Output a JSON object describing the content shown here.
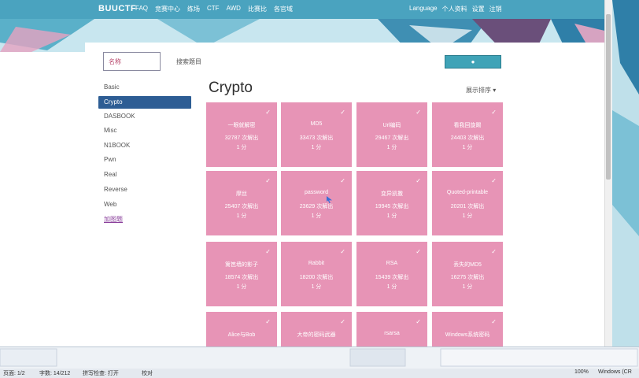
{
  "nav": {
    "brand": "BUUCTF",
    "items": [
      "FAQ",
      "竞赛中心",
      "练场",
      "CTF",
      "AWD",
      "比赛比",
      "各官域"
    ],
    "language": "Language",
    "user": "个人资料",
    "settings": "设置",
    "logout": "注销"
  },
  "search": {
    "placeholder": "名称",
    "label": "搜索题目",
    "button_icon": "search-icon"
  },
  "sidebar": {
    "items": [
      {
        "label": "Basic"
      },
      {
        "label": "Crypto",
        "active": true
      },
      {
        "label": "DASBOOK"
      },
      {
        "label": "Misc"
      },
      {
        "label": "N1BOOK"
      },
      {
        "label": "Pwn"
      },
      {
        "label": "Real"
      },
      {
        "label": "Reverse"
      },
      {
        "label": "Web"
      },
      {
        "label": "加图题"
      }
    ]
  },
  "main": {
    "title": "Crypto",
    "sort": "展示排序 ▾",
    "cards": [
      {
        "name": "一眼就解密",
        "solves": "32787 次解出",
        "score": "1 分"
      },
      {
        "name": "MD5",
        "solves": "33473 次解出",
        "score": "1 分"
      },
      {
        "name": "Url编码",
        "solves": "29467 次解出",
        "score": "1 分"
      },
      {
        "name": "看我回旋踢",
        "solves": "24403 次解出",
        "score": "1 分"
      },
      {
        "name": "摩丝",
        "solves": "25407 次解出",
        "score": "1 分"
      },
      {
        "name": "password",
        "solves": "23629 次解出",
        "score": "1 分"
      },
      {
        "name": "变异凯撒",
        "solves": "19945 次解出",
        "score": "1 分"
      },
      {
        "name": "Quoted-printable",
        "solves": "20201 次解出",
        "score": "1 分"
      },
      {
        "name": "篱笆墙的影子",
        "solves": "18574 次解出",
        "score": "1 分"
      },
      {
        "name": "Rabbit",
        "solves": "18200 次解出",
        "score": "1 分"
      },
      {
        "name": "RSA",
        "solves": "15439 次解出",
        "score": "1 分"
      },
      {
        "name": "丢失的MD5",
        "solves": "16275 次解出",
        "score": "1 分"
      },
      {
        "name": "Alice与Bob",
        "solves": "",
        "score": ""
      },
      {
        "name": "大帝的密码武器",
        "solves": "",
        "score": ""
      },
      {
        "name": "rsarsa",
        "solves": "",
        "score": ""
      },
      {
        "name": "Windows系统密码",
        "solves": "",
        "score": ""
      }
    ]
  },
  "statusbar": {
    "page": "页面: 1/2",
    "words": "字数: 14/212",
    "spell": "拼写检查: 打开",
    "proof": "校对",
    "zoom": "100%",
    "os": "Windows (CR"
  }
}
